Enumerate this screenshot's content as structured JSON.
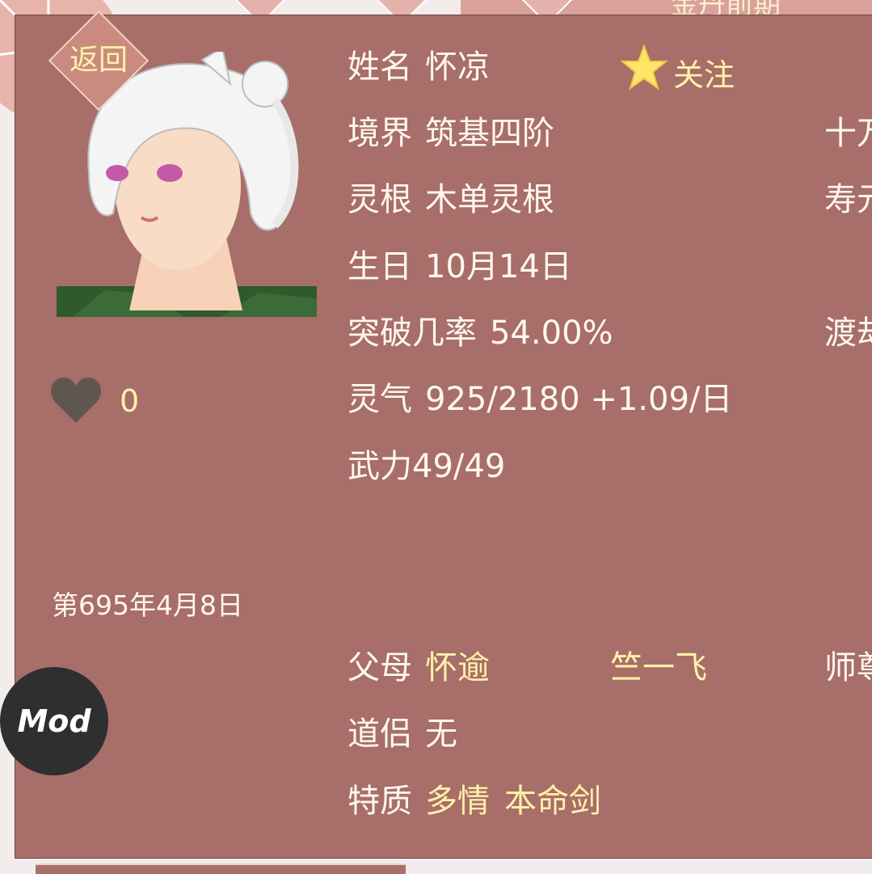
{
  "background": {
    "top_banner_text": "金丹前期"
  },
  "back_button": {
    "label": "返回"
  },
  "character": {
    "name_label": "姓名",
    "name": "怀凉",
    "follow_label": "关注",
    "realm_label": "境界",
    "realm": "筑基四阶",
    "root_label": "灵根",
    "root": "木单灵根",
    "birthday_label": "生日",
    "birthday": "10月14日",
    "breakthrough_label": "突破几率",
    "breakthrough": "54.00%",
    "qi_label": "灵气",
    "qi": "925/2180 +1.09/日",
    "force": "武力49/49",
    "parents_label": "父母",
    "parent1": "怀逾",
    "parent2": "竺一飞",
    "partner_label": "道侣",
    "partner": "无",
    "traits_label": "特质",
    "trait1": "多情",
    "trait2": "本命剑"
  },
  "right_column": {
    "r1": "十万",
    "r2": "寿元",
    "r3": "渡劫",
    "r4": "师尊"
  },
  "likes": {
    "count": "0"
  },
  "game_date": "第695年4月8日",
  "mod_button": {
    "label": "Mod"
  },
  "colors": {
    "panel": "#a86e69",
    "accent_yellow": "#fff1a8",
    "text_white": "#fff8ef",
    "heart": "#5f5650"
  }
}
